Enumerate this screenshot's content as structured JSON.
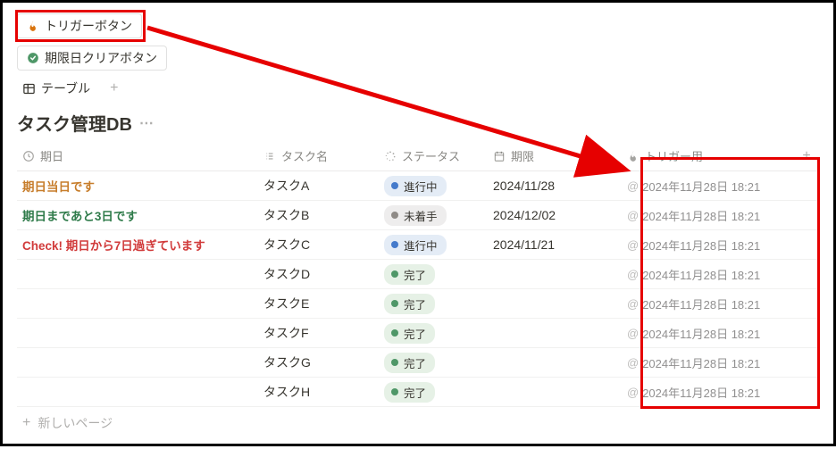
{
  "buttons": {
    "trigger": "トリガーボタン",
    "clear_deadline": "期限日クリアボタン"
  },
  "view_tab": "テーブル",
  "db_title": "タスク管理DB",
  "columns": {
    "kijitsu": "期日",
    "task_name": "タスク名",
    "status": "ステータス",
    "deadline": "期限",
    "trigger": "トリガー用"
  },
  "status_styles": {
    "進行中": {
      "bg": "#e4ecf6",
      "dot": "#447acb"
    },
    "未着手": {
      "bg": "#eeeded",
      "dot": "#8f8b87"
    },
    "完了": {
      "bg": "#e6f1e6",
      "dot": "#4f9768"
    }
  },
  "kijitsu_color": {
    "期日当日です": "#c77d2b",
    "期日まであと3日です": "#2f7b4a",
    "Check! 期日から7日過ぎています": "#d13b3b"
  },
  "trigger_timestamp": "2024年11月28日 18:21",
  "rows": [
    {
      "kijitsu": "期日当日です",
      "task": "タスクA",
      "status": "進行中",
      "deadline": "2024/11/28"
    },
    {
      "kijitsu": "期日まであと3日です",
      "task": "タスクB",
      "status": "未着手",
      "deadline": "2024/12/02"
    },
    {
      "kijitsu": "Check! 期日から7日過ぎています",
      "task": "タスクC",
      "status": "進行中",
      "deadline": "2024/11/21"
    },
    {
      "kijitsu": "",
      "task": "タスクD",
      "status": "完了",
      "deadline": ""
    },
    {
      "kijitsu": "",
      "task": "タスクE",
      "status": "完了",
      "deadline": ""
    },
    {
      "kijitsu": "",
      "task": "タスクF",
      "status": "完了",
      "deadline": ""
    },
    {
      "kijitsu": "",
      "task": "タスクG",
      "status": "完了",
      "deadline": ""
    },
    {
      "kijitsu": "",
      "task": "タスクH",
      "status": "完了",
      "deadline": ""
    }
  ],
  "new_page": "新しいページ"
}
